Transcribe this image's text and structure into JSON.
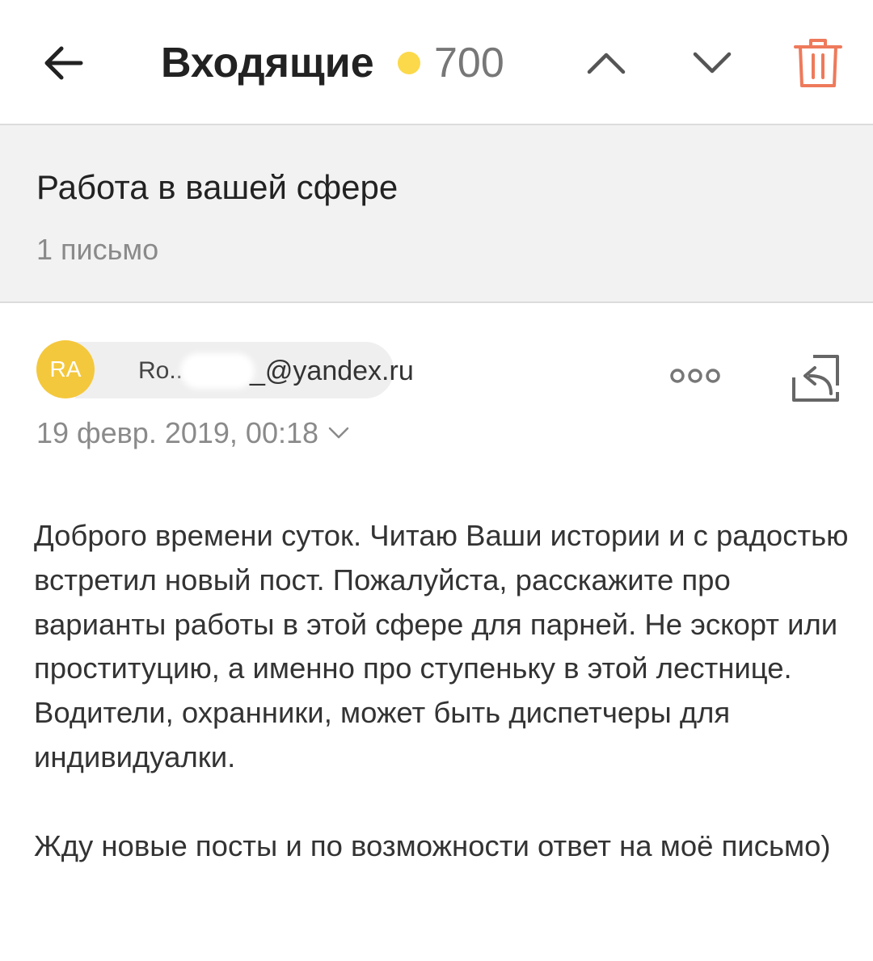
{
  "header": {
    "title": "Входящие",
    "unread_count": "700",
    "unread_dot_color": "#fcd94a",
    "back_icon": "arrow-left-icon",
    "prev_icon": "chevron-up-icon",
    "next_icon": "chevron-down-icon",
    "delete_icon": "trash-icon",
    "delete_color": "#ee7a5b"
  },
  "thread": {
    "subject": "Работа в вашей сфере",
    "count": "1 письмо"
  },
  "message": {
    "avatar_initials": "RA",
    "avatar_color": "#f4c83c",
    "sender_name": "Ro..",
    "sender_email": "_@yandex.ru",
    "date": "19 февр. 2019, 00:18",
    "more_icon": "more-dots-icon",
    "reply_icon": "reply-icon",
    "body": [
      "Доброго времени суток. Читаю Ваши истории и с радостью встретил новый пост. Пожалуйста, расскажите про варианты работы в этой сфере для парней. Не эскорт или проституцию, а именно про ступеньку в этой лестнице. Водители, охранники, может быть диспетчеры для индивидуалки.",
      "Жду новые посты и по возможности ответ на моё письмо)"
    ]
  }
}
